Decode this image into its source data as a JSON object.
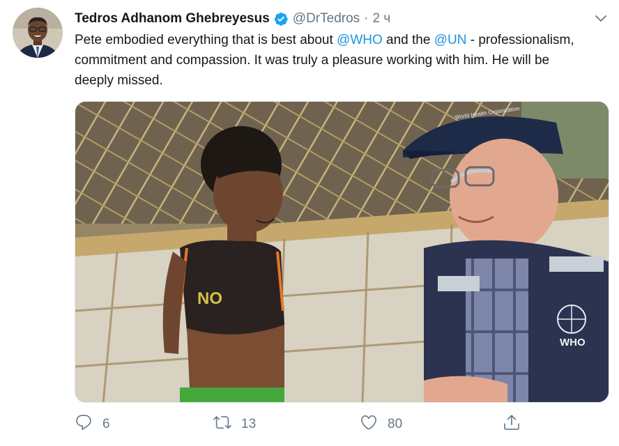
{
  "tweet": {
    "author_name": "Tedros Adhanom Ghebreyesus",
    "handle": "@DrTedros",
    "separator": "·",
    "time": "2 ч",
    "text_part1": "Pete embodied everything that is best about ",
    "mention1": "@WHO",
    "text_part2": " and the ",
    "mention2": "@UN",
    "text_part3": " - professionalism, commitment and compassion. It was truly a pleasure working with him. He will be deeply missed."
  },
  "photo": {
    "cap_text": "World Health Organization",
    "vest_logo_text": "WHO",
    "shirt_text": "NO"
  },
  "actions": {
    "reply_count": "6",
    "retweet_count": "13",
    "like_count": "80"
  },
  "icons": {
    "verified": "verified-badge-icon",
    "caret": "chevron-down-icon",
    "reply": "reply-icon",
    "retweet": "retweet-icon",
    "like": "heart-icon",
    "share": "share-icon"
  },
  "colors": {
    "text": "#14171a",
    "muted": "#657786",
    "link": "#1b95e0",
    "verified": "#1da1f2"
  }
}
